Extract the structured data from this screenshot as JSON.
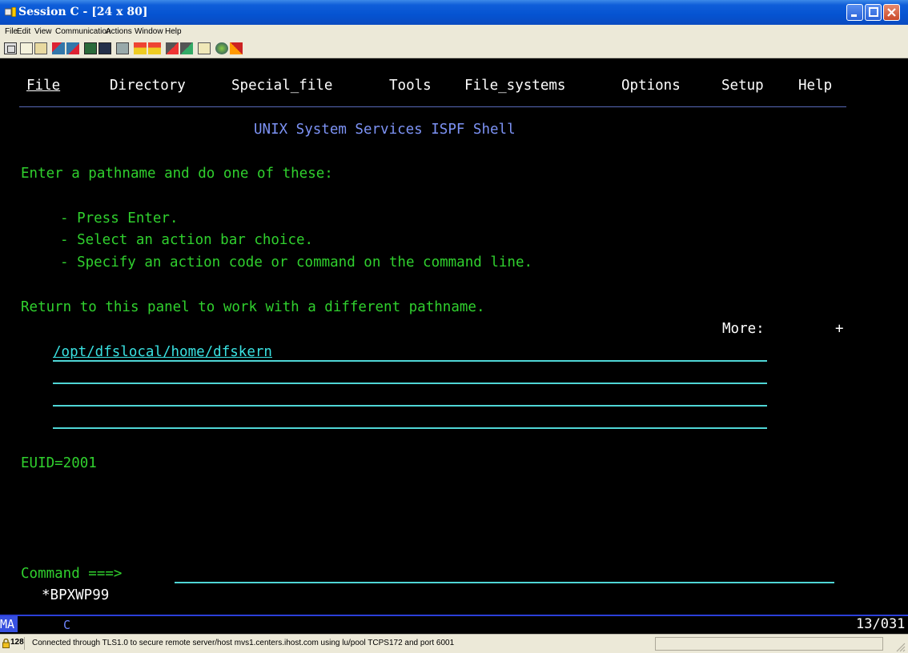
{
  "window": {
    "title": "Session C - [24 x 80]",
    "minimize_label": "_",
    "maximize_label": "□",
    "close_label": "X"
  },
  "menu": {
    "items": [
      "File",
      "Edit",
      "View",
      "Communication",
      "Actions",
      "Window",
      "Help"
    ]
  },
  "toolbar": {
    "icons": [
      "print-screen-icon",
      "copy-icon",
      "paste-icon",
      "send-file-icon",
      "receive-file-icon",
      "display-icon",
      "keypad-icon",
      "macro-icon",
      "record-macro-icon",
      "play-macro-icon",
      "transfer-icon",
      "transfer-list-icon",
      "clipboard-icon",
      "connect-icon",
      "help-icon"
    ]
  },
  "terminal": {
    "action_bar": [
      "File",
      "Directory",
      "Special_file",
      "Tools",
      "File_systems",
      "Options",
      "Setup",
      "Help"
    ],
    "panel_title": "UNIX System Services ISPF Shell",
    "instructions": "Enter a pathname and do one of these:",
    "options": [
      "- Press Enter.",
      "- Select an action bar choice.",
      "- Specify an action code or command on the command line."
    ],
    "return_text": "Return to this panel to work with a different pathname.",
    "more_label": "More:",
    "more_indicator": "+",
    "pathname_value": "/opt/dfslocal/home/dfskern",
    "euid": "EUID=2001",
    "command_label": "Command ===>",
    "command_value": "",
    "panel_id": "*BPXWP99"
  },
  "oia": {
    "indicator": "MA",
    "mode": "C",
    "cursor_position": "13/031"
  },
  "status": {
    "lock_label": "128",
    "message": "Connected through TLS1.0 to secure remote server/host mvs1.centers.ihost.com using lu/pool TCPS172 and port 6001"
  },
  "colors": {
    "titlebar": "#0553d1",
    "screen_bg": "#000000",
    "blue_text": "#7d93f5",
    "green_text": "#30d02e",
    "cyan_text": "#39e1e1",
    "white_text": "#ffffff"
  }
}
